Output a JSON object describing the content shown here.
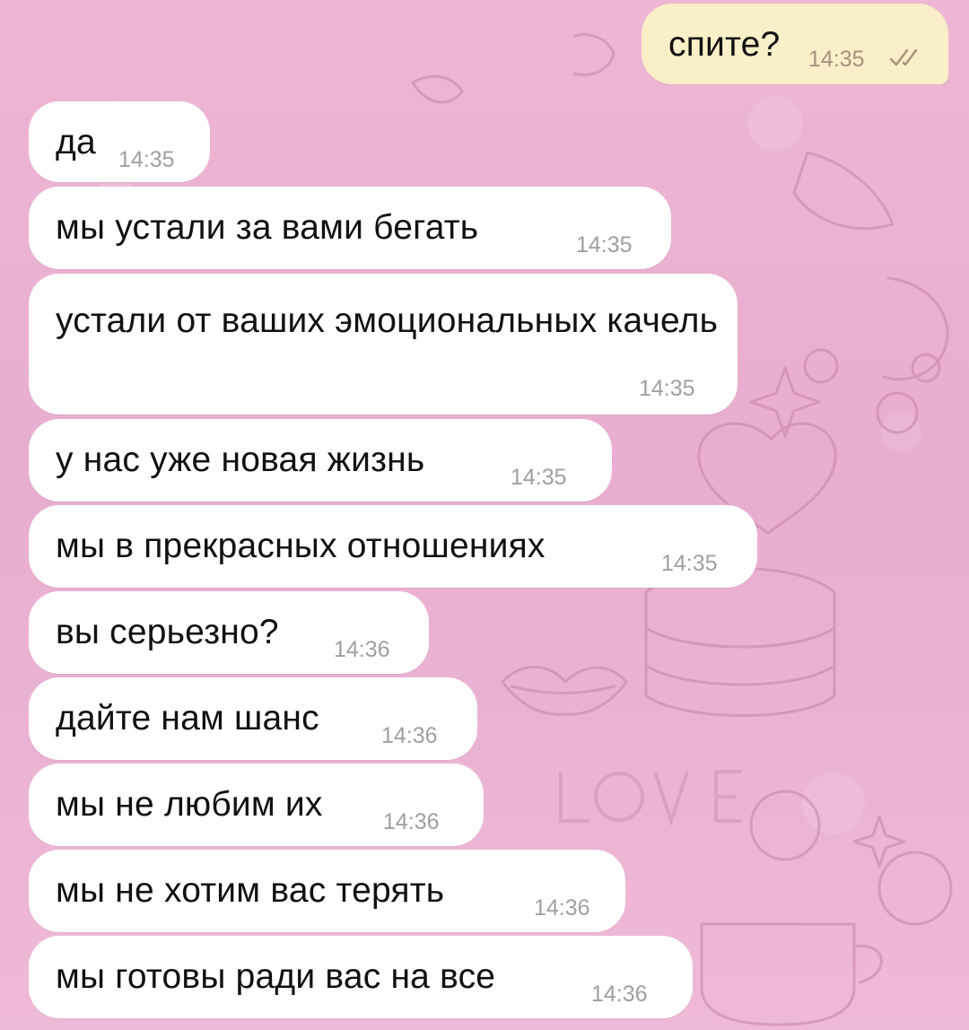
{
  "messages": [
    {
      "text": "спите?",
      "time": "14:35",
      "direction": "outgoing",
      "status_icon": "double-check-icon"
    },
    {
      "text": "да",
      "time": "14:35",
      "direction": "incoming"
    },
    {
      "text": "мы устали за вами бегать",
      "time": "14:35",
      "direction": "incoming"
    },
    {
      "text": "устали от ваших эмоциональных качель",
      "time": "14:35",
      "direction": "incoming"
    },
    {
      "text": "у нас уже новая жизнь",
      "time": "14:35",
      "direction": "incoming"
    },
    {
      "text": "мы в прекрасных отношениях",
      "time": "14:35",
      "direction": "incoming"
    },
    {
      "text": "вы серьезно?",
      "time": "14:36",
      "direction": "incoming"
    },
    {
      "text": "дайте нам шанс",
      "time": "14:36",
      "direction": "incoming"
    },
    {
      "text": "мы не любим их",
      "time": "14:36",
      "direction": "incoming"
    },
    {
      "text": "мы не хотим вас терять",
      "time": "14:36",
      "direction": "incoming"
    },
    {
      "text": "мы готовы ради вас на все",
      "time": "14:36",
      "direction": "incoming"
    }
  ],
  "colors": {
    "chat_background": "#ebb2cf",
    "incoming_bubble": "#ffffff",
    "outgoing_bubble": "#f9efc8",
    "incoming_time": "#9f9f9f",
    "outgoing_time": "#a6917e",
    "doodle_stroke": "#c985aa"
  },
  "background_doodles": [
    "love-text",
    "heart-icon",
    "lips-icon",
    "cake-icon",
    "sparkle-icon",
    "cup-icon"
  ]
}
